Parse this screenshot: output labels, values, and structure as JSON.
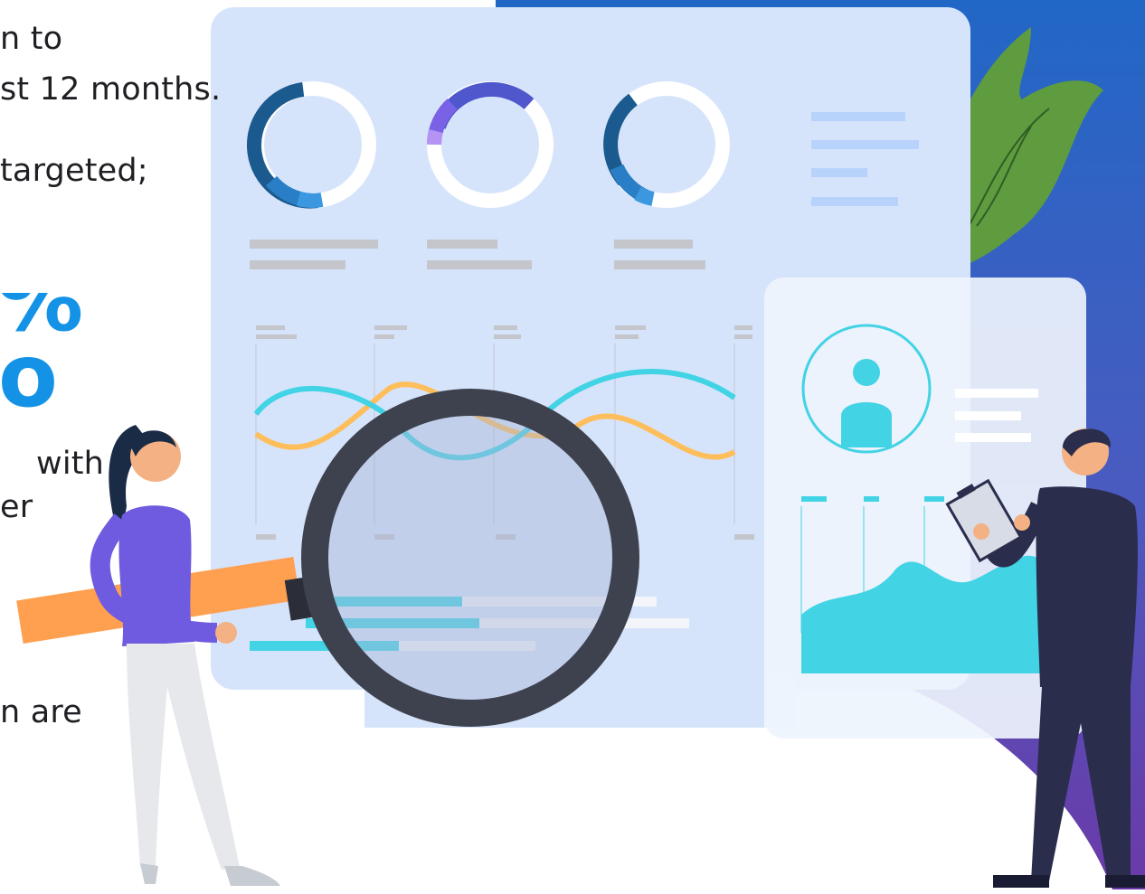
{
  "text_fragments": {
    "line1": "n to",
    "line2": "st 12 months.",
    "line3": "targeted;",
    "stat_top": "%",
    "stat_bottom": "o",
    "line4": "with",
    "line5": "er",
    "line6": "n are"
  },
  "colors": {
    "accent_blue": "#1493e6",
    "panel_light": "#d6e4fb",
    "cyan": "#42d3e5",
    "orange": "#ffbe5c",
    "magnifier": "#3e424e",
    "leaf_green": "#5f9b3f",
    "suit_navy": "#2b2d4d",
    "shirt_purple": "#6e5be0",
    "gradient_top": "#2167c6",
    "gradient_bottom": "#6b3aa8"
  },
  "illustration": {
    "subject": "analytics-dashboard-with-people",
    "icons": [
      "donut-chart-icon",
      "wave-chart-icon",
      "magnifying-glass-icon",
      "user-profile-icon",
      "clipboard-icon",
      "leaf-icon"
    ]
  }
}
